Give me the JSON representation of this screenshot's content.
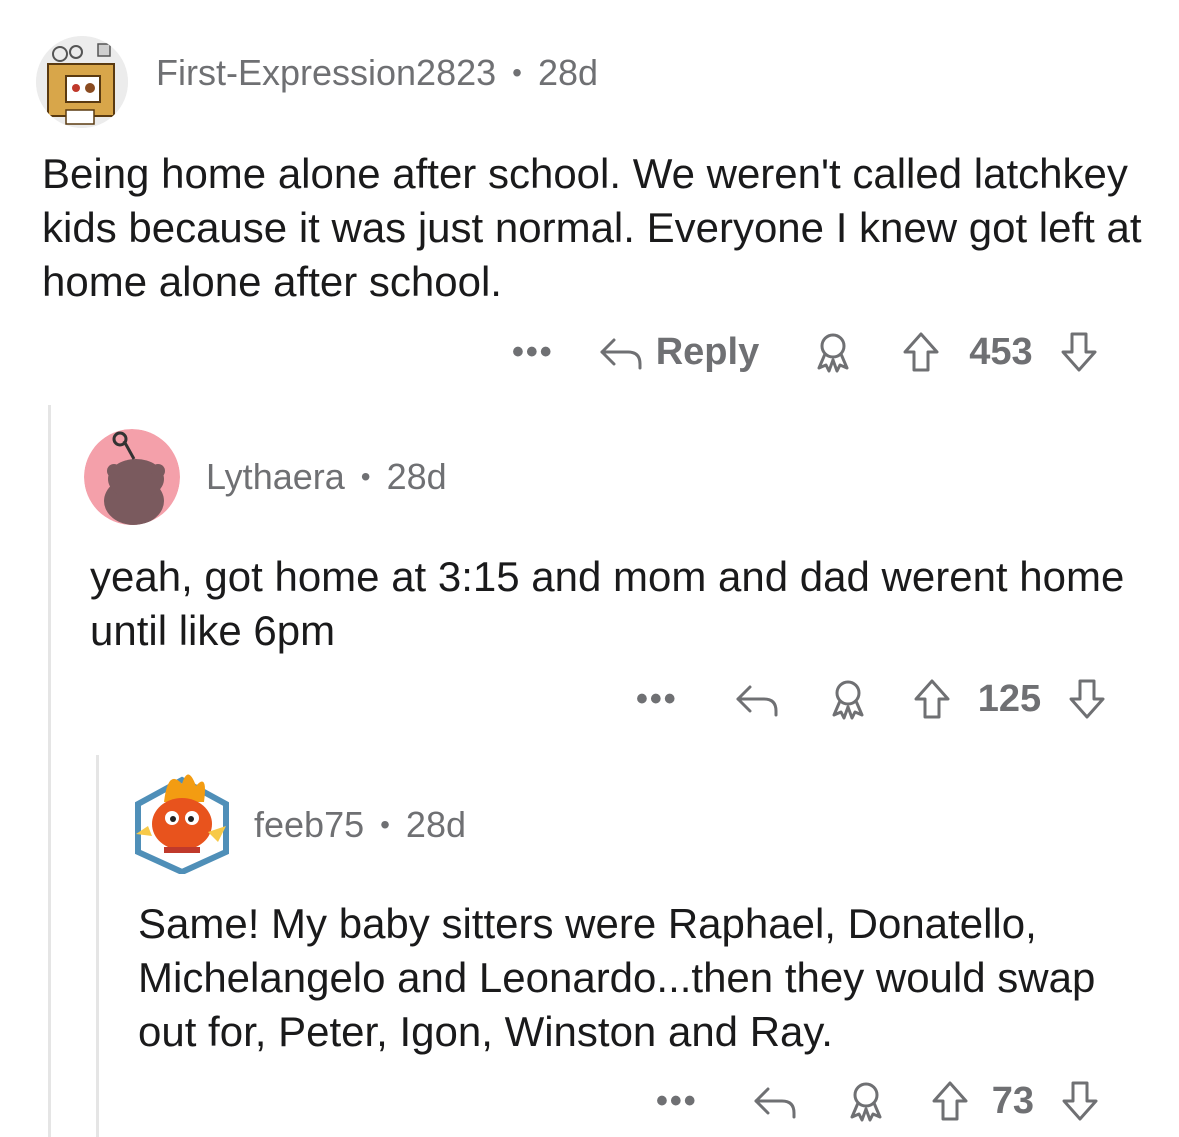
{
  "comments": [
    {
      "username": "First-Expression2823",
      "separator": "•",
      "age": "28d",
      "text": "Being home alone after school. We weren't called latchkey kids because it was just normal. Everyone I knew got left at home alone after school.",
      "more_label": "•••",
      "reply_label": "Reply",
      "score": "453"
    },
    {
      "username": "Lythaera",
      "separator": "•",
      "age": "28d",
      "text": "yeah, got home at 3:15 and mom and dad werent home until like 6pm",
      "more_label": "•••",
      "score": "125"
    },
    {
      "username": "feeb75",
      "separator": "•",
      "age": "28d",
      "text": "Same! My baby sitters were Raphael, Donatello, Michelangelo and Leonardo...then they would swap out for, Peter, Igon, Winston and Ray.",
      "more_label": "•••",
      "score": "73"
    }
  ],
  "icons": {
    "reply": "reply-arrow-icon",
    "award": "award-icon",
    "upvote": "upvote-arrow-icon",
    "downvote": "downvote-arrow-icon"
  },
  "colors": {
    "text": "#1a1a1b",
    "meta": "#6f7073",
    "thread_line": "#e5e5e5",
    "avatar_pink": "#f4a0aa"
  }
}
